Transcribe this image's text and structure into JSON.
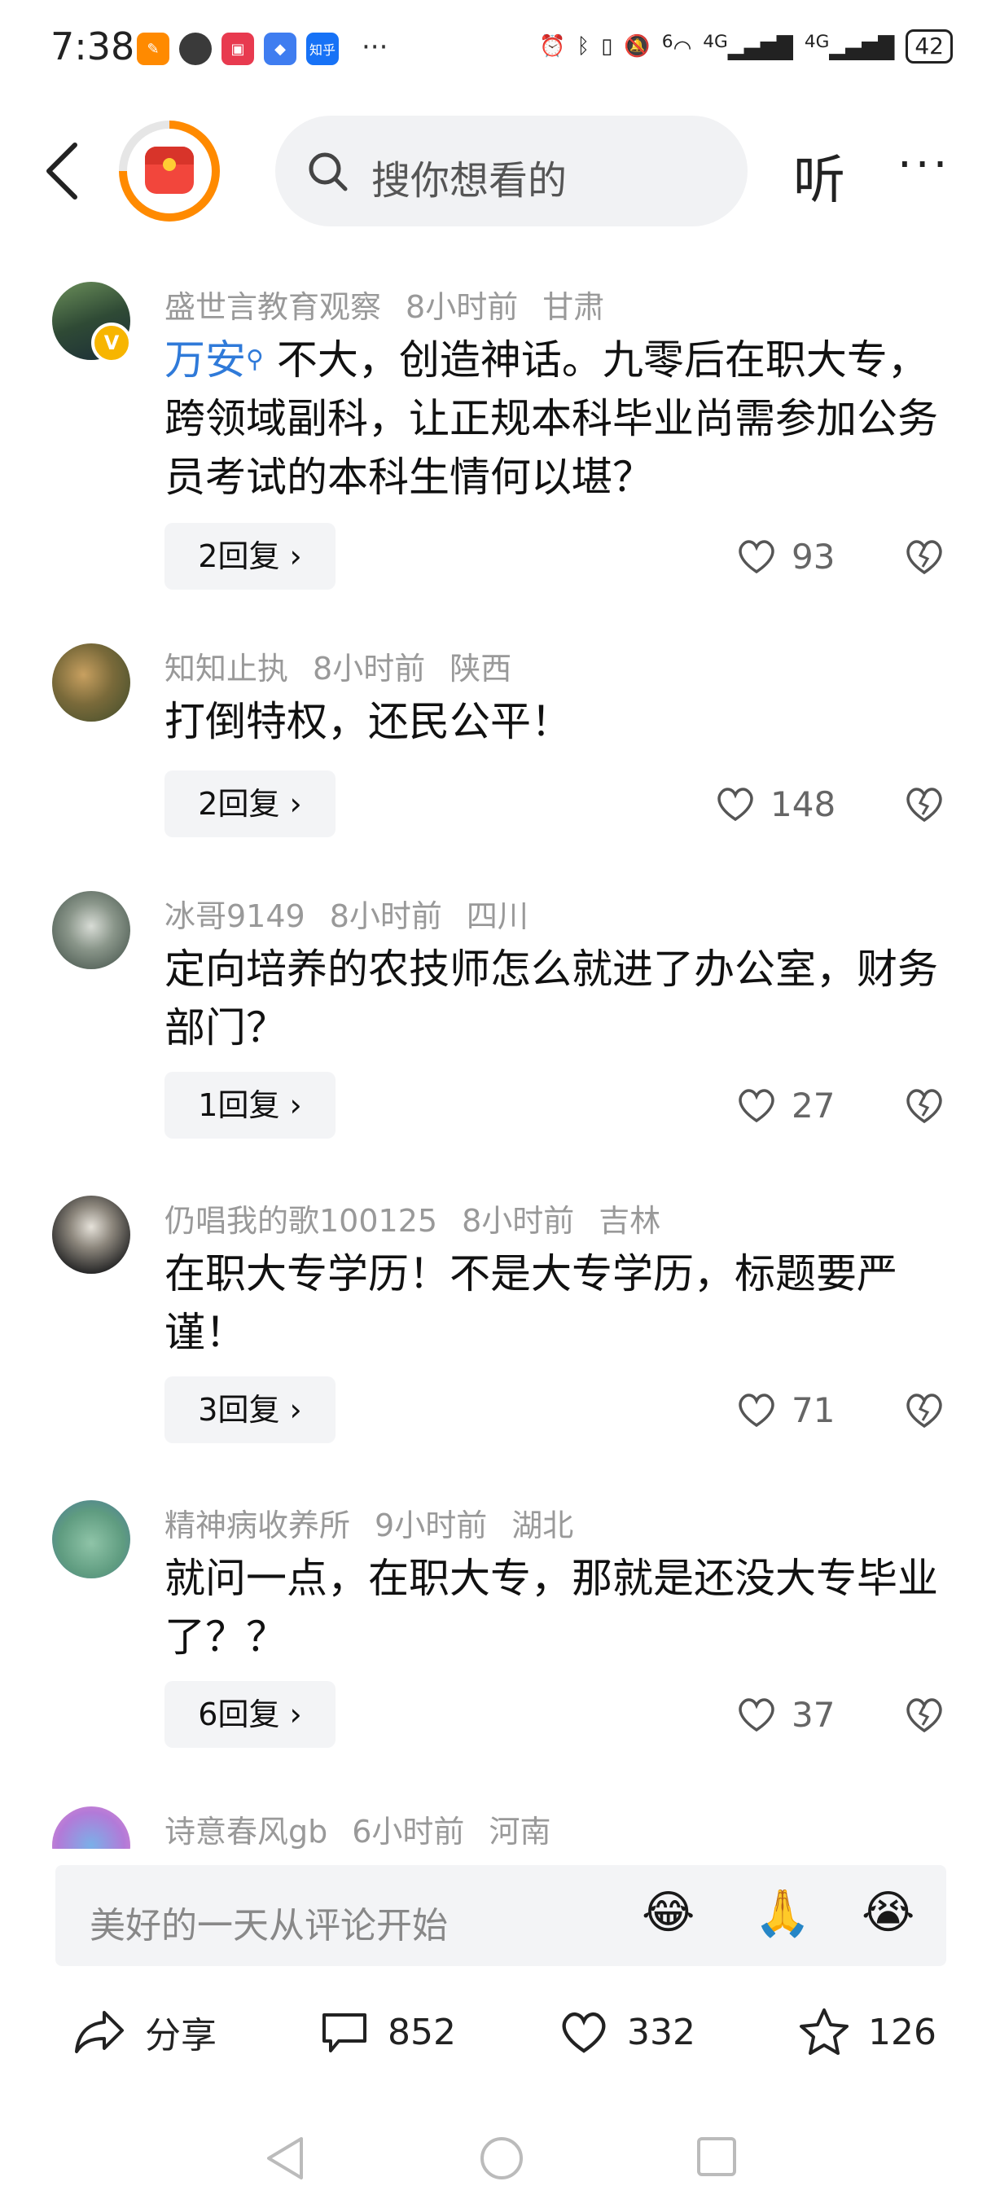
{
  "status_bar": {
    "time": "7:38",
    "apps": [
      {
        "name": "app-icon-orange",
        "color": "#ff8a00"
      },
      {
        "name": "app-icon-avatar",
        "color": "#3a3a3a"
      },
      {
        "name": "app-icon-red",
        "color": "#e83a4f"
      },
      {
        "name": "app-icon-blue",
        "color": "#3f7df0"
      },
      {
        "name": "zhihu-icon",
        "color": "#1772f6",
        "label": "知乎"
      }
    ],
    "more": "···",
    "signal_1": "4G",
    "signal_2": "4G",
    "wifi_label": "6",
    "battery": "42"
  },
  "topbar": {
    "search_placeholder": "搜你想看的",
    "listen_label": "听",
    "menu_label": "···"
  },
  "comments": [
    {
      "user": "盛世言教育观察",
      "time": "8小时前",
      "location": "甘肃",
      "link_text": "万安",
      "text": "不大，创造神话。九零后在职大专，跨领域副科，让正规本科毕业尚需参加公务员考试的本科生情何以堪？",
      "replies": "2回复 ›",
      "likes": "93"
    },
    {
      "user": "知知止执",
      "time": "8小时前",
      "location": "陕西",
      "text": "打倒特权，还民公平！",
      "replies": "2回复 ›",
      "likes": "148"
    },
    {
      "user": "冰哥9149",
      "time": "8小时前",
      "location": "四川",
      "text": "定向培养的农技师怎么就进了办公室，财务部门？",
      "replies": "1回复 ›",
      "likes": "27"
    },
    {
      "user": "仍唱我的歌100125",
      "time": "8小时前",
      "location": "吉林",
      "text": "在职大专学历！不是大专学历，标题要严谨！",
      "replies": "3回复 ›",
      "likes": "71"
    },
    {
      "user": "精神病收养所",
      "time": "9小时前",
      "location": "湖北",
      "text": "就问一点，在职大专，那就是还没大专毕业了？？",
      "replies": "6回复 ›",
      "likes": "37"
    },
    {
      "user": "诗意春风gb",
      "time": "6小时前",
      "location": "河南"
    }
  ],
  "input_bar": {
    "placeholder": "美好的一天从评论开始",
    "emojis": [
      "😂",
      "🙏",
      "😭"
    ]
  },
  "actions": {
    "share_label": "分享",
    "comments_count": "852",
    "likes_count": "332",
    "favorites_count": "126"
  }
}
